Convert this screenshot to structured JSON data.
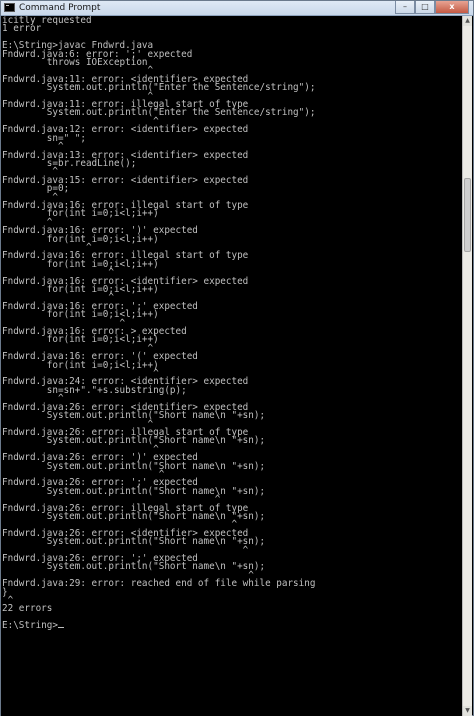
{
  "window": {
    "title": "Command Prompt",
    "icon": "console-icon",
    "controls": {
      "minimize": "–",
      "maximize": "□",
      "close": "x"
    }
  },
  "console": {
    "lines": [
      "icitly requested",
      "1 error",
      "",
      "E:\\String>javac Fndwrd.java",
      "Fndwrd.java:6: error: ';' expected",
      "        throws IOException",
      "                          ^",
      "Fndwrd.java:11: error: <identifier> expected",
      "        System.out.println(\"Enter the Sentence/string\");",
      "                          ^",
      "Fndwrd.java:11: error: illegal start of type",
      "        System.out.println(\"Enter the Sentence/string\");",
      "                           ^",
      "Fndwrd.java:12: error: <identifier> expected",
      "        sn=\" \";",
      "          ^",
      "Fndwrd.java:13: error: <identifier> expected",
      "        s=br.readLine();",
      "         ^",
      "Fndwrd.java:15: error: <identifier> expected",
      "        p=0;",
      "         ^",
      "Fndwrd.java:16: error: illegal start of type",
      "        for(int i=0;i<l;i++)",
      "        ^",
      "Fndwrd.java:16: error: ')' expected",
      "        for(int i=0;i<l;i++)",
      "               ^",
      "Fndwrd.java:16: error: illegal start of type",
      "        for(int i=0;i<l;i++)",
      "                   ^",
      "Fndwrd.java:16: error: <identifier> expected",
      "        for(int i=0;i<l;i++)",
      "                   ^",
      "Fndwrd.java:16: error: ';' expected",
      "        for(int i=0;i<l;i++)",
      "                     ^",
      "Fndwrd.java:16: error: > expected",
      "        for(int i=0;i<l;i++)",
      "                          ^",
      "Fndwrd.java:16: error: '(' expected",
      "        for(int i=0;i<l;i++)",
      "                           ^",
      "Fndwrd.java:24: error: <identifier> expected",
      "        sn=sn+\".\"+s.substring(p);",
      "          ^",
      "Fndwrd.java:26: error: <identifier> expected",
      "        System.out.println(\"Short name\\n \"+sn);",
      "                          ^",
      "Fndwrd.java:26: error: illegal start of type",
      "        System.out.println(\"Short name\\n \"+sn);",
      "                           ^",
      "Fndwrd.java:26: error: ')' expected",
      "        System.out.println(\"Short name\\n \"+sn);",
      "                            ^",
      "Fndwrd.java:26: error: ';' expected",
      "        System.out.println(\"Short name\\n \"+sn);",
      "                                      ^",
      "Fndwrd.java:26: error: illegal start of type",
      "        System.out.println(\"Short name\\n \"+sn);",
      "                                         ^",
      "Fndwrd.java:26: error: <identifier> expected",
      "        System.out.println(\"Short name\\n \"+sn);",
      "                                           ^",
      "Fndwrd.java:26: error: ';' expected",
      "        System.out.println(\"Short name\\n \"+sn);",
      "                                            ^",
      "Fndwrd.java:29: error: reached end of file while parsing",
      "}",
      " ^",
      "22 errors",
      "",
      "E:\\String>"
    ]
  },
  "colors": {
    "background": "#000000",
    "text": "#c0c0c0",
    "titlebar": "#dfe9f5",
    "close_button": "#c45a44"
  }
}
